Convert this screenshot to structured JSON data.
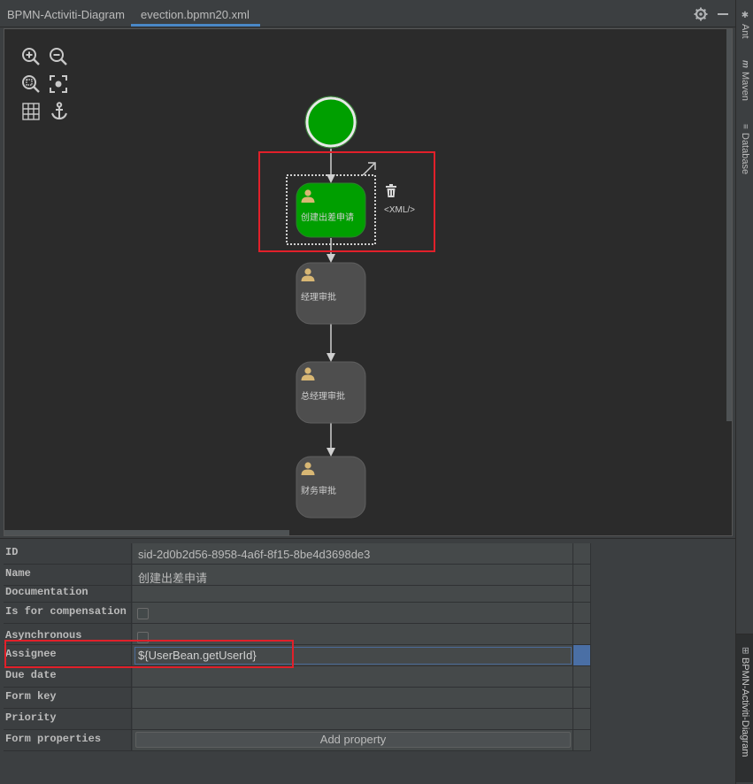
{
  "tabs": {
    "plugin_title": "BPMN-Activiti-Diagram",
    "file_tab": "evection.bpmn20.xml"
  },
  "right_panel": {
    "ant": "Ant",
    "maven": "Maven",
    "database": "Database",
    "bpmn": "BPMN-Activiti-Diagram"
  },
  "toolbar_icons": [
    "zoom-in-icon",
    "zoom-out-icon",
    "zoom-actual-icon",
    "fit-screen-icon",
    "grid-icon",
    "anchor-icon"
  ],
  "diagram": {
    "tasks": [
      {
        "label": "创建出差申请",
        "selected": true
      },
      {
        "label": "经理审批",
        "selected": false
      },
      {
        "label": "总经理审批",
        "selected": false
      },
      {
        "label": "财务审批",
        "selected": false
      }
    ],
    "xml_label": "<XML/>",
    "colors": {
      "start_event": "#009f00",
      "selected_task": "#009f00",
      "task": "#4e4e4e",
      "user_icon": "#d8b774"
    }
  },
  "properties": {
    "id_label": "ID",
    "id_value": "sid-2d0b2d56-8958-4a6f-8f15-8be4d3698de3",
    "name_label": "Name",
    "name_value": "创建出差申请",
    "documentation_label": "Documentation",
    "compensation_label": "Is for compensation",
    "asynchronous_label": "Asynchronous",
    "assignee_label": "Assignee",
    "assignee_value": "${UserBean.getUserId}",
    "due_date_label": "Due date",
    "form_key_label": "Form key",
    "priority_label": "Priority",
    "form_properties_label": "Form properties",
    "add_property_label": "Add property"
  }
}
